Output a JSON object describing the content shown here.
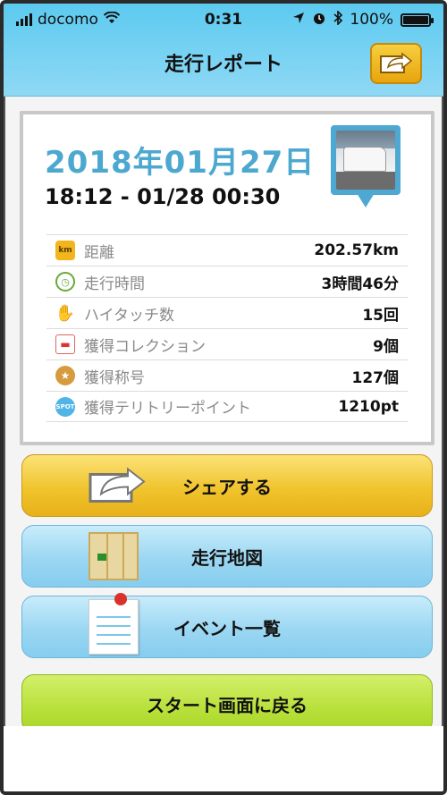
{
  "status_bar": {
    "carrier": "docomo",
    "time": "0:31",
    "battery": "100%"
  },
  "nav": {
    "title": "走行レポート"
  },
  "report": {
    "date": "2018年01月27日",
    "time_range": "18:12 - 01/28 00:30",
    "stats": [
      {
        "icon": "km",
        "label": "距離",
        "value": "202.57km"
      },
      {
        "icon": "",
        "label": "走行時間",
        "value": "3時間46分"
      },
      {
        "icon": "",
        "label": "ハイタッチ数",
        "value": "15回"
      },
      {
        "icon": "",
        "label": "獲得コレクション",
        "value": "9個"
      },
      {
        "icon": "",
        "label": "獲得称号",
        "value": "127個"
      },
      {
        "icon": "SPOT",
        "label": "獲得テリトリーポイント",
        "value": "1210pt"
      }
    ]
  },
  "buttons": {
    "share": "シェアする",
    "map": "走行地図",
    "events": "イベント一覧",
    "back": "スタート画面に戻る"
  }
}
